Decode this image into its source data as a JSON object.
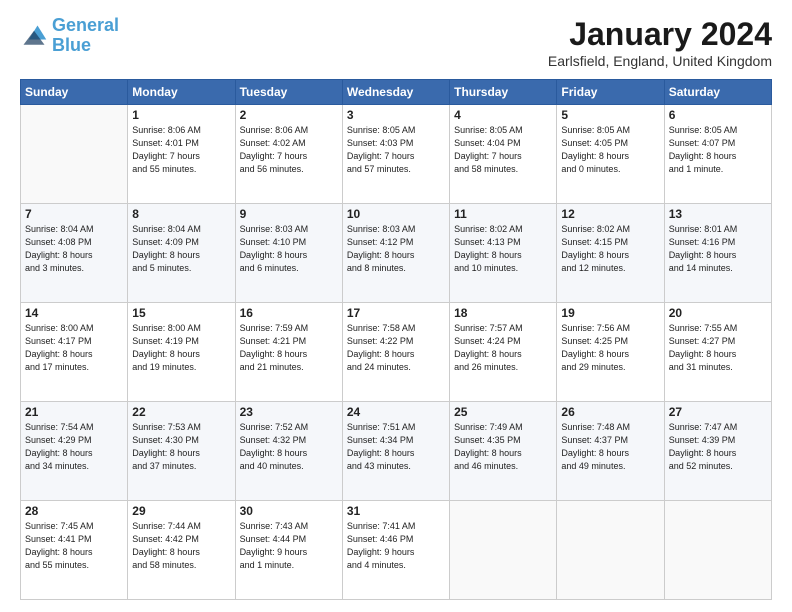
{
  "logo": {
    "line1": "General",
    "line2": "Blue"
  },
  "title": "January 2024",
  "location": "Earlsfield, England, United Kingdom",
  "days_header": [
    "Sunday",
    "Monday",
    "Tuesday",
    "Wednesday",
    "Thursday",
    "Friday",
    "Saturday"
  ],
  "weeks": [
    [
      {
        "num": "",
        "info": ""
      },
      {
        "num": "1",
        "info": "Sunrise: 8:06 AM\nSunset: 4:01 PM\nDaylight: 7 hours\nand 55 minutes."
      },
      {
        "num": "2",
        "info": "Sunrise: 8:06 AM\nSunset: 4:02 AM\nDaylight: 7 hours\nand 56 minutes."
      },
      {
        "num": "3",
        "info": "Sunrise: 8:05 AM\nSunset: 4:03 PM\nDaylight: 7 hours\nand 57 minutes."
      },
      {
        "num": "4",
        "info": "Sunrise: 8:05 AM\nSunset: 4:04 PM\nDaylight: 7 hours\nand 58 minutes."
      },
      {
        "num": "5",
        "info": "Sunrise: 8:05 AM\nSunset: 4:05 PM\nDaylight: 8 hours\nand 0 minutes."
      },
      {
        "num": "6",
        "info": "Sunrise: 8:05 AM\nSunset: 4:07 PM\nDaylight: 8 hours\nand 1 minute."
      }
    ],
    [
      {
        "num": "7",
        "info": "Sunrise: 8:04 AM\nSunset: 4:08 PM\nDaylight: 8 hours\nand 3 minutes."
      },
      {
        "num": "8",
        "info": "Sunrise: 8:04 AM\nSunset: 4:09 PM\nDaylight: 8 hours\nand 5 minutes."
      },
      {
        "num": "9",
        "info": "Sunrise: 8:03 AM\nSunset: 4:10 PM\nDaylight: 8 hours\nand 6 minutes."
      },
      {
        "num": "10",
        "info": "Sunrise: 8:03 AM\nSunset: 4:12 PM\nDaylight: 8 hours\nand 8 minutes."
      },
      {
        "num": "11",
        "info": "Sunrise: 8:02 AM\nSunset: 4:13 PM\nDaylight: 8 hours\nand 10 minutes."
      },
      {
        "num": "12",
        "info": "Sunrise: 8:02 AM\nSunset: 4:15 PM\nDaylight: 8 hours\nand 12 minutes."
      },
      {
        "num": "13",
        "info": "Sunrise: 8:01 AM\nSunset: 4:16 PM\nDaylight: 8 hours\nand 14 minutes."
      }
    ],
    [
      {
        "num": "14",
        "info": "Sunrise: 8:00 AM\nSunset: 4:17 PM\nDaylight: 8 hours\nand 17 minutes."
      },
      {
        "num": "15",
        "info": "Sunrise: 8:00 AM\nSunset: 4:19 PM\nDaylight: 8 hours\nand 19 minutes."
      },
      {
        "num": "16",
        "info": "Sunrise: 7:59 AM\nSunset: 4:21 PM\nDaylight: 8 hours\nand 21 minutes."
      },
      {
        "num": "17",
        "info": "Sunrise: 7:58 AM\nSunset: 4:22 PM\nDaylight: 8 hours\nand 24 minutes."
      },
      {
        "num": "18",
        "info": "Sunrise: 7:57 AM\nSunset: 4:24 PM\nDaylight: 8 hours\nand 26 minutes."
      },
      {
        "num": "19",
        "info": "Sunrise: 7:56 AM\nSunset: 4:25 PM\nDaylight: 8 hours\nand 29 minutes."
      },
      {
        "num": "20",
        "info": "Sunrise: 7:55 AM\nSunset: 4:27 PM\nDaylight: 8 hours\nand 31 minutes."
      }
    ],
    [
      {
        "num": "21",
        "info": "Sunrise: 7:54 AM\nSunset: 4:29 PM\nDaylight: 8 hours\nand 34 minutes."
      },
      {
        "num": "22",
        "info": "Sunrise: 7:53 AM\nSunset: 4:30 PM\nDaylight: 8 hours\nand 37 minutes."
      },
      {
        "num": "23",
        "info": "Sunrise: 7:52 AM\nSunset: 4:32 PM\nDaylight: 8 hours\nand 40 minutes."
      },
      {
        "num": "24",
        "info": "Sunrise: 7:51 AM\nSunset: 4:34 PM\nDaylight: 8 hours\nand 43 minutes."
      },
      {
        "num": "25",
        "info": "Sunrise: 7:49 AM\nSunset: 4:35 PM\nDaylight: 8 hours\nand 46 minutes."
      },
      {
        "num": "26",
        "info": "Sunrise: 7:48 AM\nSunset: 4:37 PM\nDaylight: 8 hours\nand 49 minutes."
      },
      {
        "num": "27",
        "info": "Sunrise: 7:47 AM\nSunset: 4:39 PM\nDaylight: 8 hours\nand 52 minutes."
      }
    ],
    [
      {
        "num": "28",
        "info": "Sunrise: 7:45 AM\nSunset: 4:41 PM\nDaylight: 8 hours\nand 55 minutes."
      },
      {
        "num": "29",
        "info": "Sunrise: 7:44 AM\nSunset: 4:42 PM\nDaylight: 8 hours\nand 58 minutes."
      },
      {
        "num": "30",
        "info": "Sunrise: 7:43 AM\nSunset: 4:44 PM\nDaylight: 9 hours\nand 1 minute."
      },
      {
        "num": "31",
        "info": "Sunrise: 7:41 AM\nSunset: 4:46 PM\nDaylight: 9 hours\nand 4 minutes."
      },
      {
        "num": "",
        "info": ""
      },
      {
        "num": "",
        "info": ""
      },
      {
        "num": "",
        "info": ""
      }
    ]
  ]
}
